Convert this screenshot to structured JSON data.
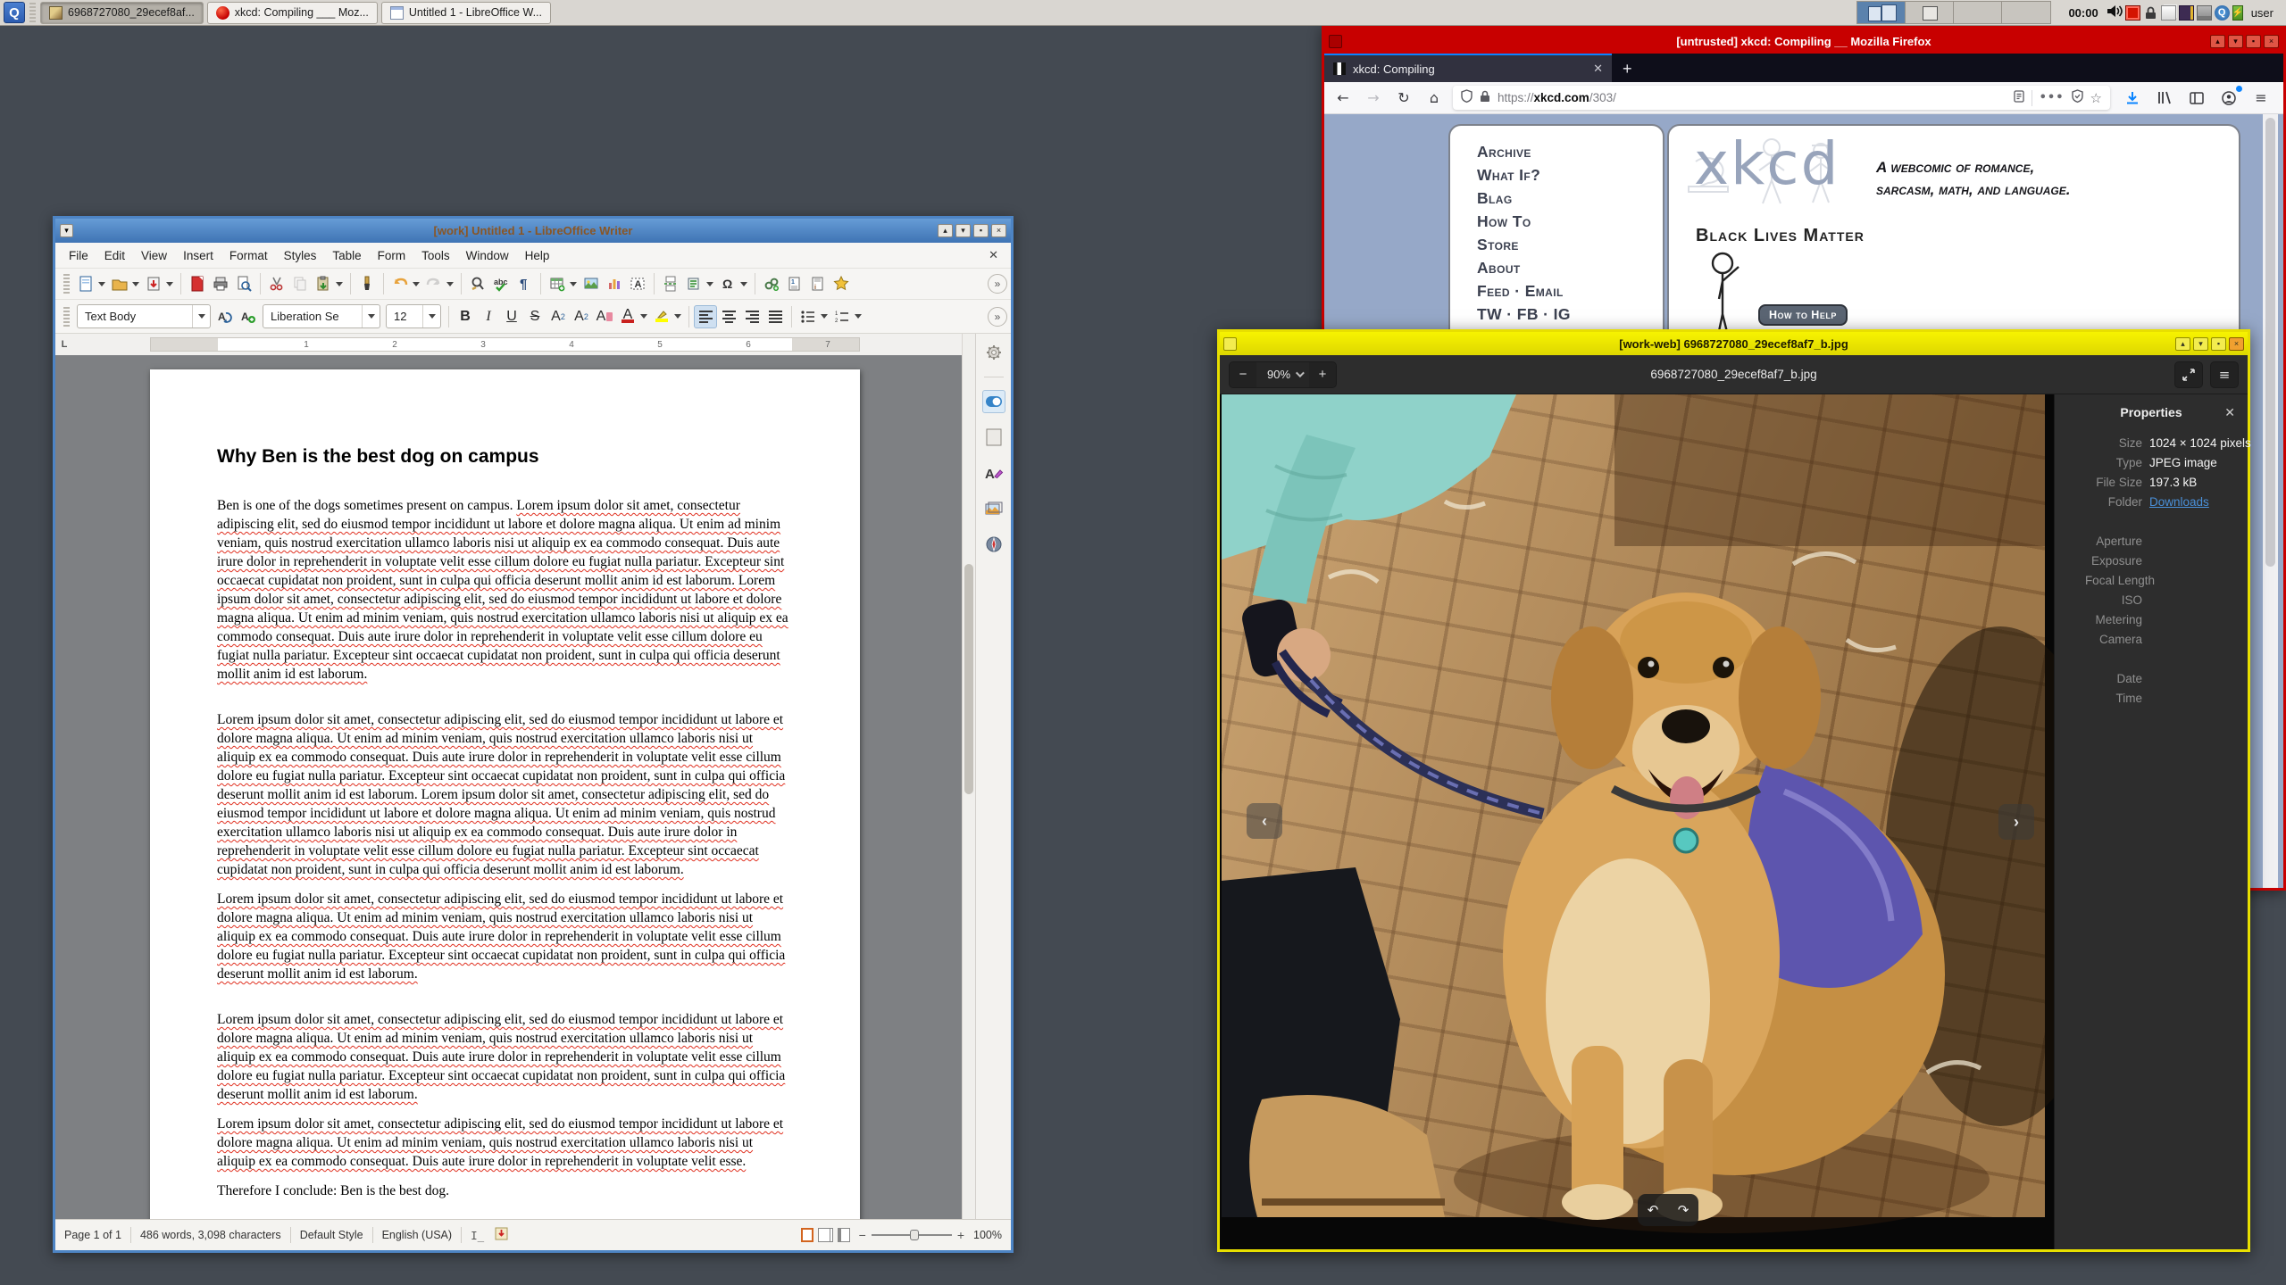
{
  "taskbar": {
    "menu_label": "Q",
    "clock": "00:00",
    "user_label": "user",
    "windows": [
      {
        "label": "6968727080_29ecef8af...",
        "icon": "image-thumbnail-icon",
        "active": true
      },
      {
        "label": "xkcd: Compiling ___ Moz...",
        "icon": "firefox-icon",
        "active": false
      },
      {
        "label": "Untitled 1 - LibreOffice W...",
        "icon": "writer-document-icon",
        "active": false
      }
    ],
    "tray_icons": [
      "volume-icon",
      "display-red-icon",
      "padlock-icon",
      "documents-icon",
      "device-icon",
      "disk-icon",
      "qubes-icon",
      "battery-icon"
    ]
  },
  "writer": {
    "title": "[work] Untitled 1 - LibreOffice Writer",
    "menus": [
      "File",
      "Edit",
      "View",
      "Insert",
      "Format",
      "Styles",
      "Table",
      "Form",
      "Tools",
      "Window",
      "Help"
    ],
    "close_glyph": "✕",
    "formatting": {
      "paragraph_style": "Text Body",
      "font_name": "Liberation Se",
      "font_size": "12"
    },
    "ruler_numbers": [
      "1",
      "2",
      "3",
      "4",
      "5",
      "6",
      "7"
    ],
    "tab_selector": "L",
    "document": {
      "heading": "Why Ben is the best dog on campus",
      "p1_intro": "Ben is one of the dogs sometimes present on campus. ",
      "p1_lorem": "Lorem ipsum dolor sit amet, consectetur adipiscing elit, sed do eiusmod tempor incididunt ut labore et dolore magna aliqua. Ut enim ad minim veniam, quis nostrud exercitation ullamco laboris nisi ut aliquip ex ea commodo consequat. Duis aute irure dolor in reprehenderit in voluptate velit esse cillum dolore eu fugiat nulla pariatur. Excepteur sint occaecat cupidatat non proident, sunt in culpa qui officia deserunt mollit anim id est laborum. Lorem ipsum dolor sit amet, consectetur adipiscing elit, sed do eiusmod tempor incididunt ut labore et dolore magna aliqua. Ut enim ad minim veniam, quis nostrud exercitation ullamco laboris nisi ut aliquip ex ea commodo consequat. Duis aute irure dolor in reprehenderit in voluptate velit esse cillum dolore eu fugiat nulla pariatur. Excepteur sint occaecat cupidatat non proident, sunt in culpa qui officia deserunt mollit anim id est laborum.",
      "p2": "Lorem ipsum dolor sit amet, consectetur adipiscing elit, sed do eiusmod tempor incididunt ut labore et dolore magna aliqua. Ut enim ad minim veniam, quis nostrud exercitation ullamco laboris nisi ut aliquip ex ea commodo consequat. Duis aute irure dolor in reprehenderit in voluptate velit esse cillum dolore eu fugiat nulla pariatur. Excepteur sint occaecat cupidatat non proident, sunt in culpa qui officia deserunt mollit anim id est laborum. Lorem ipsum dolor sit amet, consectetur adipiscing elit, sed do eiusmod tempor incididunt ut labore et dolore magna aliqua. Ut enim ad minim veniam, quis nostrud exercitation ullamco laboris nisi ut aliquip ex ea commodo consequat. Duis aute irure dolor in reprehenderit in voluptate velit esse cillum dolore eu fugiat nulla pariatur. Excepteur sint occaecat cupidatat non proident, sunt in culpa qui officia deserunt mollit anim id est laborum.",
      "p3": "Lorem ipsum dolor sit amet, consectetur adipiscing elit, sed do eiusmod tempor incididunt ut labore et dolore magna aliqua. Ut enim ad minim veniam, quis nostrud exercitation ullamco laboris nisi ut aliquip ex ea commodo consequat. Duis aute irure dolor in reprehenderit in voluptate velit esse cillum dolore eu fugiat nulla pariatur. Excepteur sint occaecat cupidatat non proident, sunt in culpa qui officia deserunt mollit anim id est laborum.",
      "p4": "Lorem ipsum dolor sit amet, consectetur adipiscing elit, sed do eiusmod tempor incididunt ut labore et dolore magna aliqua. Ut enim ad minim veniam, quis nostrud exercitation ullamco laboris nisi ut aliquip ex ea commodo consequat. Duis aute irure dolor in reprehenderit in voluptate velit esse cillum dolore eu fugiat nulla pariatur. Excepteur sint occaecat cupidatat non proident, sunt in culpa qui officia deserunt mollit anim id est laborum.",
      "p5": "Lorem ipsum dolor sit amet, consectetur adipiscing elit, sed do eiusmod tempor incididunt ut labore et dolore magna aliqua. Ut enim ad minim veniam, quis nostrud exercitation ullamco laboris nisi ut aliquip ex ea commodo consequat. Duis aute irure dolor in reprehenderit in voluptate velit esse.",
      "conclusion": "Therefore I conclude: Ben is the best dog."
    },
    "statusbar": {
      "page": "Page 1 of 1",
      "words": "486 words, 3,098 characters",
      "style": "Default Style",
      "language": "English (USA)",
      "zoom": "100%"
    }
  },
  "firefox": {
    "title": "[untrusted] xkcd: Compiling __ Mozilla Firefox",
    "tab_title": "xkcd: Compiling",
    "url_scheme": "https://",
    "url_host": "xkcd.com",
    "url_path": "/303/",
    "xkcd": {
      "links": [
        "Archive",
        "What If?",
        "Blag",
        "How To",
        "Store",
        "About",
        "Feed · Email",
        "TW · FB · IG"
      ],
      "logo": "xkcd",
      "tagline_line1": "A webcomic of romance,",
      "tagline_line2": "sarcasm, math, and language.",
      "blm": "Black Lives Matter",
      "help_button": "How to Help"
    }
  },
  "viewer": {
    "title": "[work-web] 6968727080_29ecef8af7_b.jpg",
    "zoom_level": "90%",
    "filename": "6968727080_29ecef8af7_b.jpg",
    "properties": {
      "title": "Properties",
      "size_label": "Size",
      "size_value": "1024 × 1024 pixels",
      "type_label": "Type",
      "type_value": "JPEG image",
      "filesize_label": "File Size",
      "filesize_value": "197.3 kB",
      "folder_label": "Folder",
      "folder_value": "Downloads",
      "exif_labels": [
        "Aperture",
        "Exposure",
        "Focal Length",
        "ISO",
        "Metering",
        "Camera"
      ],
      "datetime_labels": [
        "Date",
        "Time"
      ]
    }
  },
  "colors": {
    "qubes_red": "#c80000",
    "qubes_yellow": "#e8df00",
    "qubes_blue": "#4d84c4",
    "xkcd_background": "#96a8c8",
    "firefox_accent": "#0a84ff",
    "link_blue": "#4a90d9"
  }
}
